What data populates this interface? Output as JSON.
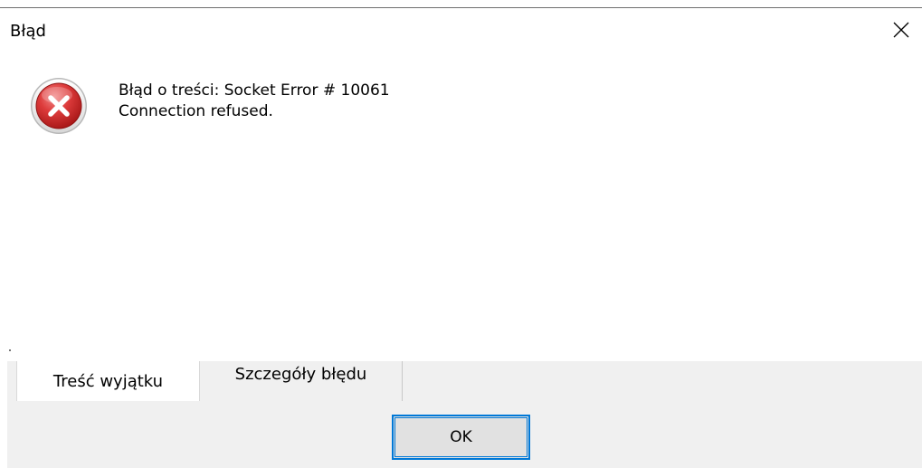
{
  "window": {
    "title": "Błąd"
  },
  "message": {
    "line1": "Błąd o treści: Socket Error # 10061",
    "line2": "Connection refused."
  },
  "icons": {
    "error": "error-icon",
    "close": "close-icon"
  },
  "tabs": [
    {
      "label": "Treść wyjątku",
      "active": true
    },
    {
      "label": "Szczegóły błędu",
      "active": false
    }
  ],
  "buttons": {
    "ok_label": "OK"
  },
  "colors": {
    "accent": "#0078d7",
    "error_red": "#d32f2f",
    "dialog_bg": "#f0f0f0"
  }
}
